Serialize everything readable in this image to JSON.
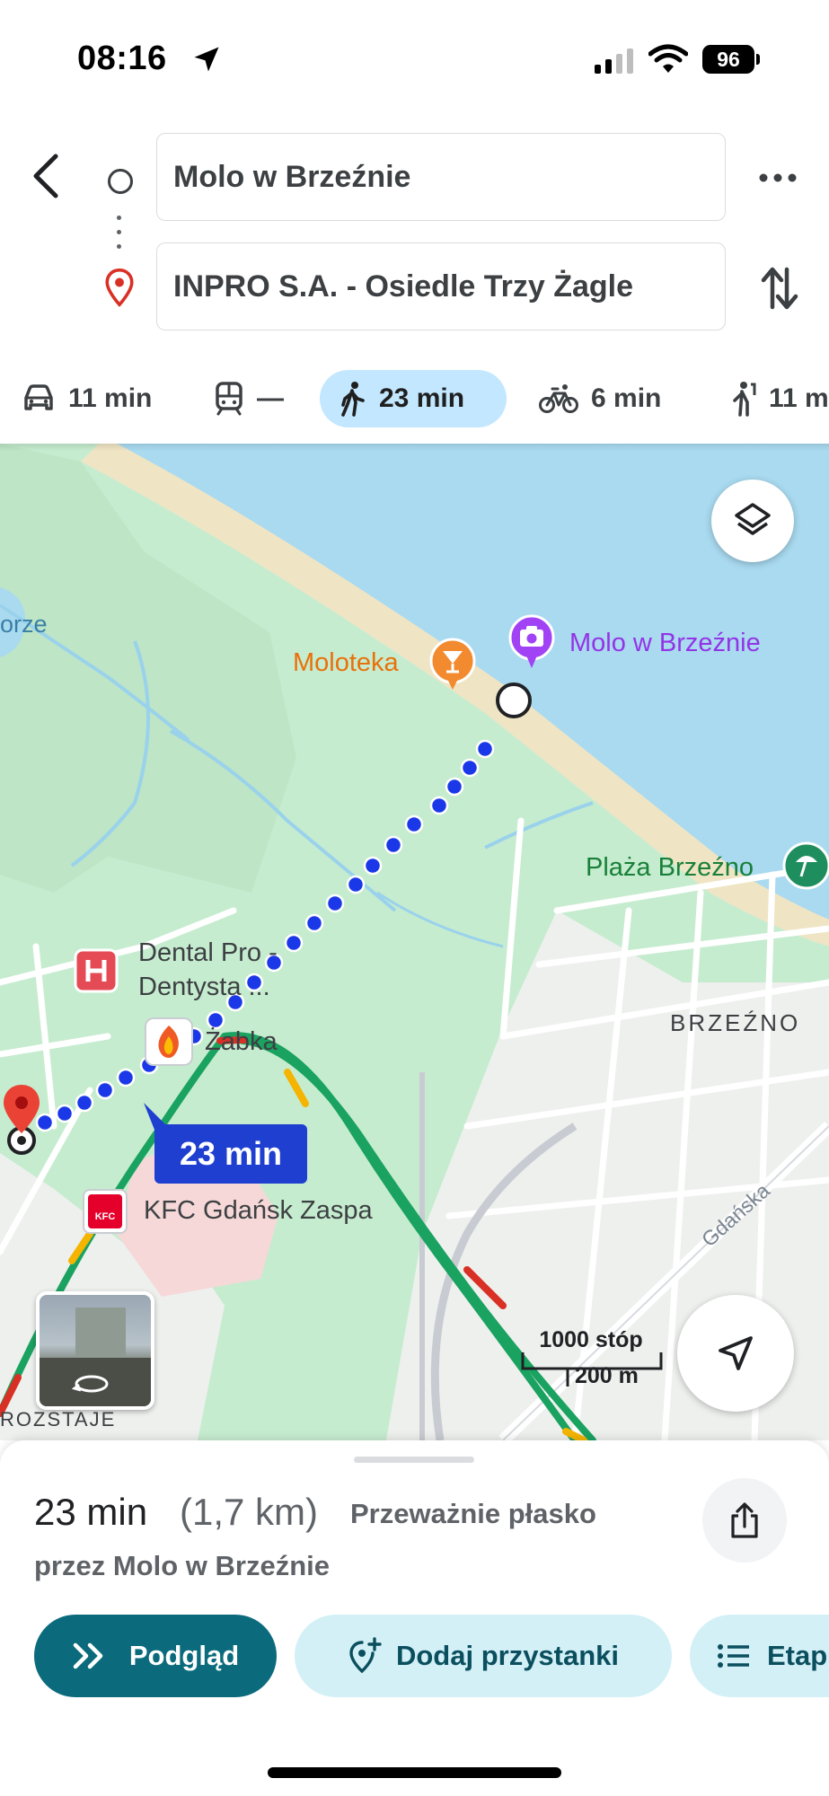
{
  "status_bar": {
    "time": "08:16",
    "battery": "96"
  },
  "route_inputs": {
    "origin": "Molo w Brzeźnie",
    "destination": "INPRO S.A. - Osiedle Trzy Żagle"
  },
  "travel_modes": [
    {
      "icon": "car-icon",
      "label": "11 min"
    },
    {
      "icon": "train-icon",
      "label": "—"
    },
    {
      "icon": "walk-icon",
      "label": "23 min",
      "active": true
    },
    {
      "icon": "bike-icon",
      "label": "6 min"
    },
    {
      "icon": "ride-icon",
      "label": "11 m"
    }
  ],
  "map": {
    "labels": {
      "orze": "orze",
      "moloteka": "Moloteka",
      "molo": "Molo w Brzeźnie",
      "plaza": "Plaża Brzeźno",
      "dental_line1": "Dental Pro -",
      "dental_line2": "Dentysta ...",
      "zabka": "Żabka",
      "brzezno": "BRZEŹNO",
      "kfc": "KFC Gdańsk Zaspa",
      "gdanska": "Gdańska",
      "rozstaje": "ROZSTAJE",
      "kfc_logo": "KFC"
    },
    "route_badge": "23 min",
    "scale": {
      "top": "1000 stóp",
      "bottom": "200 m"
    },
    "colors": {
      "water": "#a9daf0",
      "park": "#c6eccf",
      "route": "#1a38e8",
      "traffic_green": "#1aa260",
      "traffic_red": "#d93025",
      "traffic_yellow": "#f4b400"
    }
  },
  "summary": {
    "duration": "23 min",
    "distance": "(1,7 km)",
    "terrain": "Przeważnie płasko",
    "via": "przez Molo w Brzeźnie"
  },
  "actions": {
    "preview": "Podgląd",
    "add_stops": "Dodaj przystanki",
    "steps": "Etap"
  }
}
